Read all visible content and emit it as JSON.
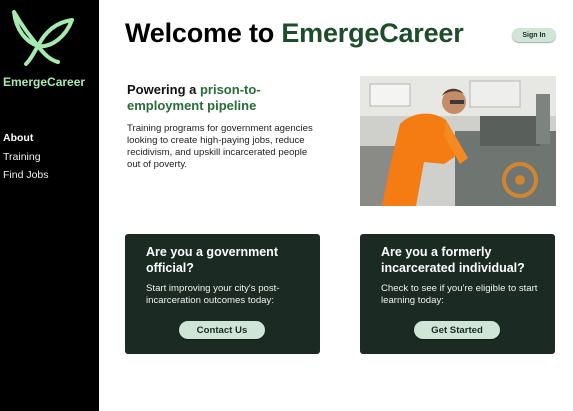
{
  "sidebar": {
    "brand": "EmergeCareer",
    "logo_icon": "leaf-bird-icon",
    "items": [
      {
        "label": "About",
        "active": true
      },
      {
        "label": "Training",
        "active": false
      },
      {
        "label": "Find Jobs",
        "active": false
      }
    ]
  },
  "header": {
    "title_prefix": "Welcome to ",
    "title_brand": "EmergeCareer",
    "signin_label": "Sign In"
  },
  "hero": {
    "heading_prefix": "Powering a ",
    "heading_accent": "prison-to-employment pipeline",
    "body": "Training programs for government agencies looking to create high-paying jobs, reduce recidivism, and upskill incarcerated people out of poverty."
  },
  "cards": [
    {
      "heading": "Are you a government official?",
      "body": "Start improving your city's post-incarceration outcomes today:",
      "button": "Contact Us"
    },
    {
      "heading": "Are you a formerly incarcerated individual?",
      "body": "Check to see if you're eligible to start learning today:",
      "button": "Get Started"
    }
  ],
  "colors": {
    "sidebar_bg": "#000000",
    "brand_green": "#a6e9b1",
    "title_accent": "#1e4d2b",
    "card_bg": "#1c2a24",
    "button_bg": "#cfe5d5"
  }
}
